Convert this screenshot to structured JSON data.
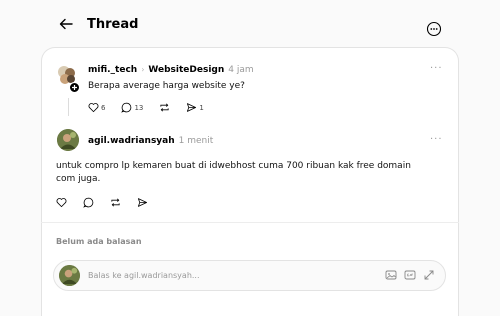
{
  "header": {
    "title": "Thread"
  },
  "post": {
    "username": "mifi._tech",
    "community": "WebsiteDesign",
    "time": "4 jam",
    "text": "Berapa average harga website ye?",
    "likes": "6",
    "comments": "13",
    "shares": "1"
  },
  "reply": {
    "username": "agil.wadriansyah",
    "time": "1 menit",
    "text_line1": "untuk compro lp kemaren buat di idwebhost cuma 700 ribuan kak free domain",
    "text_line2": "com juga."
  },
  "no_reply_label": "Belum ada balasan",
  "reply_box": {
    "placeholder": "Balas ke agil.wadriansyah..."
  },
  "colors": {
    "card_border": "#e3e3e3",
    "muted": "#9a9a9a"
  }
}
